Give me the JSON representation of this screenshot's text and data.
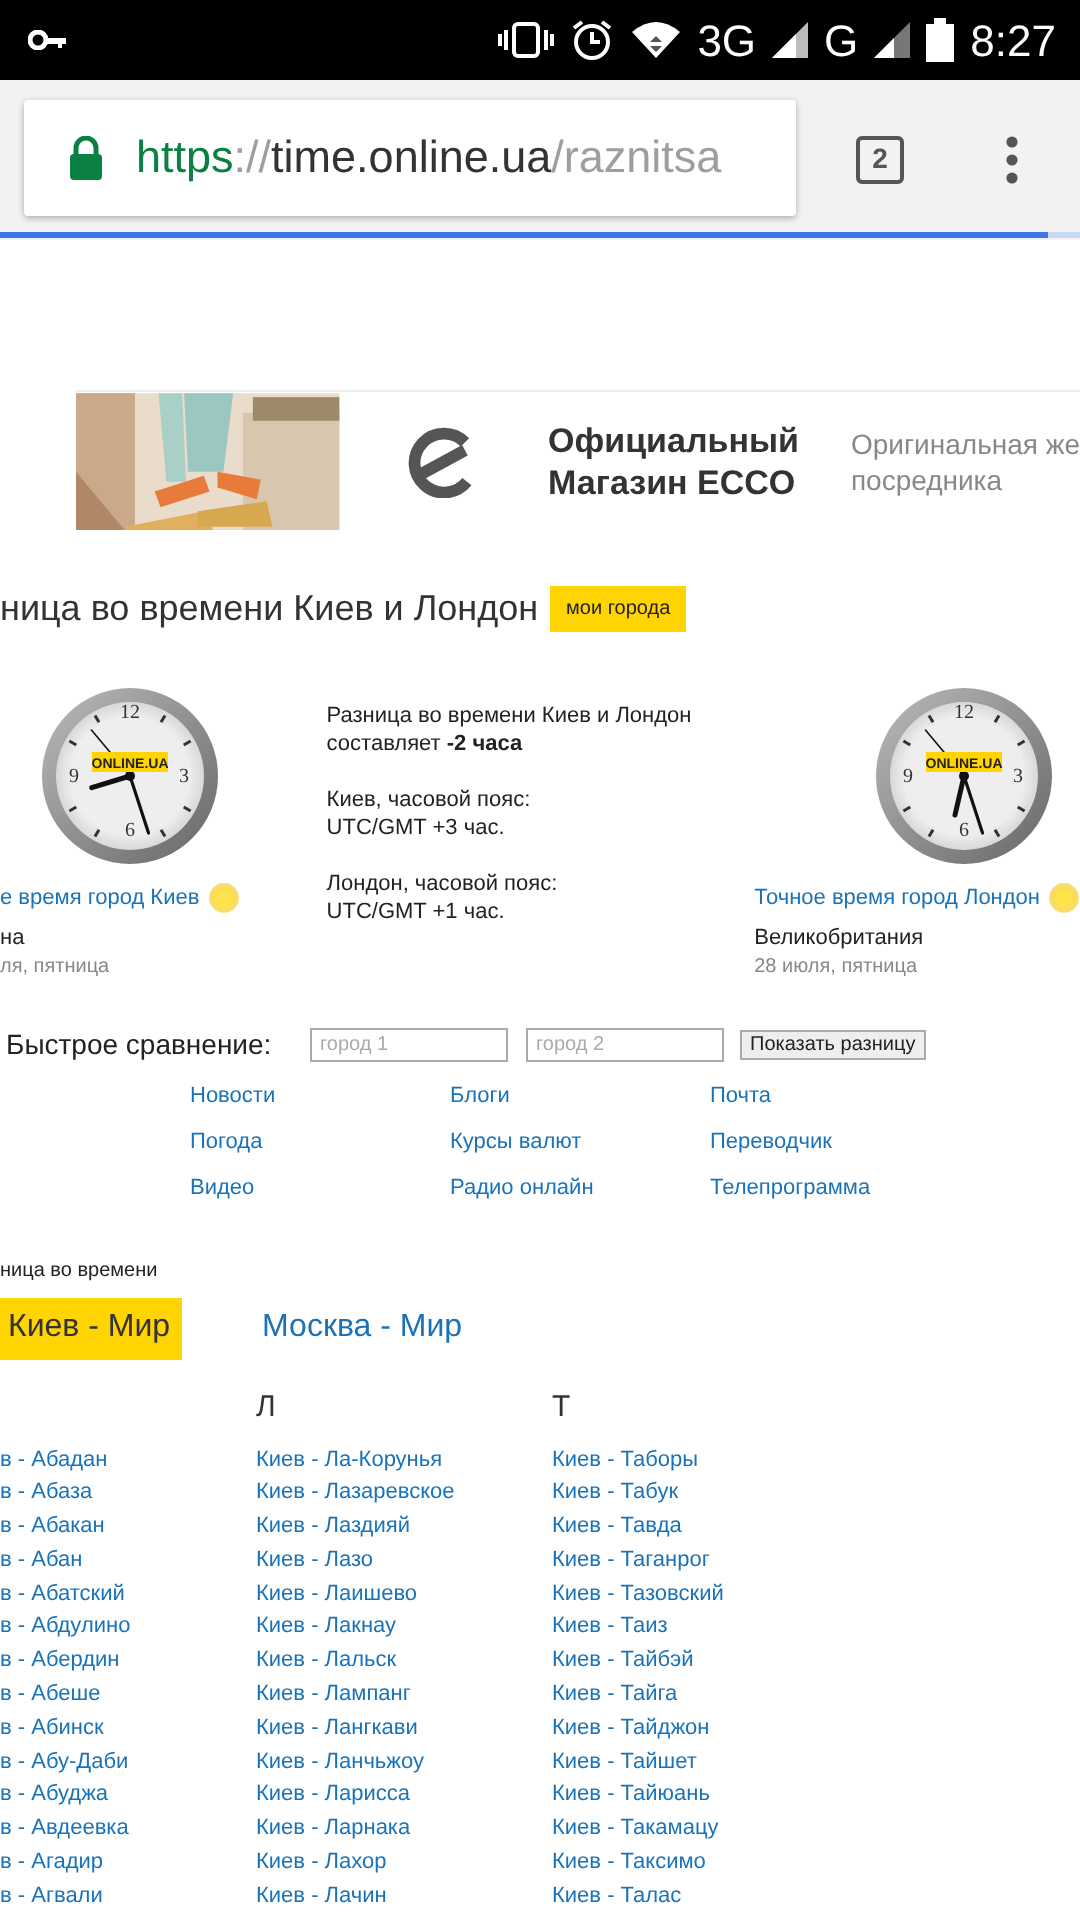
{
  "status_bar": {
    "network_1": "3G",
    "network_2": "G",
    "time": "8:27"
  },
  "browser": {
    "url_scheme": "https",
    "url_separator": "://",
    "url_host": "time.online.ua",
    "url_path": "/raznitsa",
    "tab_count": "2",
    "progress": {
      "level": 0.97
    }
  },
  "ad": {
    "image": {
      "kind": "picture"
    },
    "title_lines": [
      "Официальный",
      "Магазин ECCO"
    ],
    "description_lines": [
      "Оригинальная же",
      "посредника"
    ]
  },
  "heading": {
    "title": "ница во времени Киев и Лондон",
    "badge": "мои города"
  },
  "clocks": [
    {
      "numerals": [
        "12",
        "3",
        "6",
        "9"
      ],
      "logo": "ONLINE.UA",
      "link": "е время город Киев",
      "country": "на",
      "date": "ля, пятница"
    },
    {
      "numerals": [
        "12",
        "3",
        "6",
        "9"
      ],
      "logo": "ONLINE.UA",
      "link": "Точное время город Лондон",
      "country": "Великобритания",
      "date": "28 июля, пятница"
    }
  ],
  "difference": {
    "paragraphs": [
      [
        "Разница во времени Киев и Лондон",
        "составляет **-2 часа**"
      ],
      [
        "Киев, часовой пояс:",
        "UTC/GMT +3 час."
      ],
      [
        "Лондон, часовой пояс:",
        "UTC/GMT +1 час."
      ]
    ]
  },
  "quick_compare": {
    "label": "Быстрое сравнение:",
    "city_1": {
      "placeholder": "город 1"
    },
    "city_2": {
      "placeholder": "город 2"
    },
    "button": "Показать разницу"
  },
  "services": [
    [
      "Новости",
      "Блоги",
      "Почта"
    ],
    [
      "Погода",
      "Курсы валют",
      "Переводчик"
    ],
    [
      "Видео",
      "Радио онлайн",
      "Телепрограмма"
    ]
  ],
  "section_label": "ница во времени",
  "tabs": [
    {
      "label": "Киев - Мир",
      "selected": true
    },
    {
      "label": "Москва - Мир",
      "selected": false
    }
  ],
  "columns": [
    {
      "items": [
        "в - Абадан",
        "в - Абаза",
        "в - Абакан",
        "в - Абан",
        "в - Абатский",
        "в - Абдулино",
        "в - Абердин",
        "в - Абеше",
        "в - Абинск",
        "в - Абу-Даби",
        "в - Абуджа",
        "в - Авдеевка",
        "в - Агадир",
        "в - Агвали"
      ]
    },
    {
      "letter": "Л",
      "items": [
        "Киев - Ла-Корунья",
        "Киев - Лазаревское",
        "Киев - Лаздияй",
        "Киев - Лазо",
        "Киев - Лаишево",
        "Киев - Лакнау",
        "Киев - Лальск",
        "Киев - Лампанг",
        "Киев - Лангкави",
        "Киев - Ланчьжоу",
        "Киев - Ларисса",
        "Киев - Ларнака",
        "Киев - Лахор",
        "Киев - Лачин"
      ]
    },
    {
      "letter": "Т",
      "items": [
        "Киев - Таборы",
        "Киев - Табук",
        "Киев - Тавда",
        "Киев - Таганрог",
        "Киев - Тазовский",
        "Киев - Таиз",
        "Киев - Тайбэй",
        "Киев - Тайга",
        "Киев - Тайджон",
        "Киев - Тайшет",
        "Киев - Тайюань",
        "Киев - Такамацу",
        "Киев - Таксимо",
        "Киев - Талас"
      ]
    }
  ]
}
